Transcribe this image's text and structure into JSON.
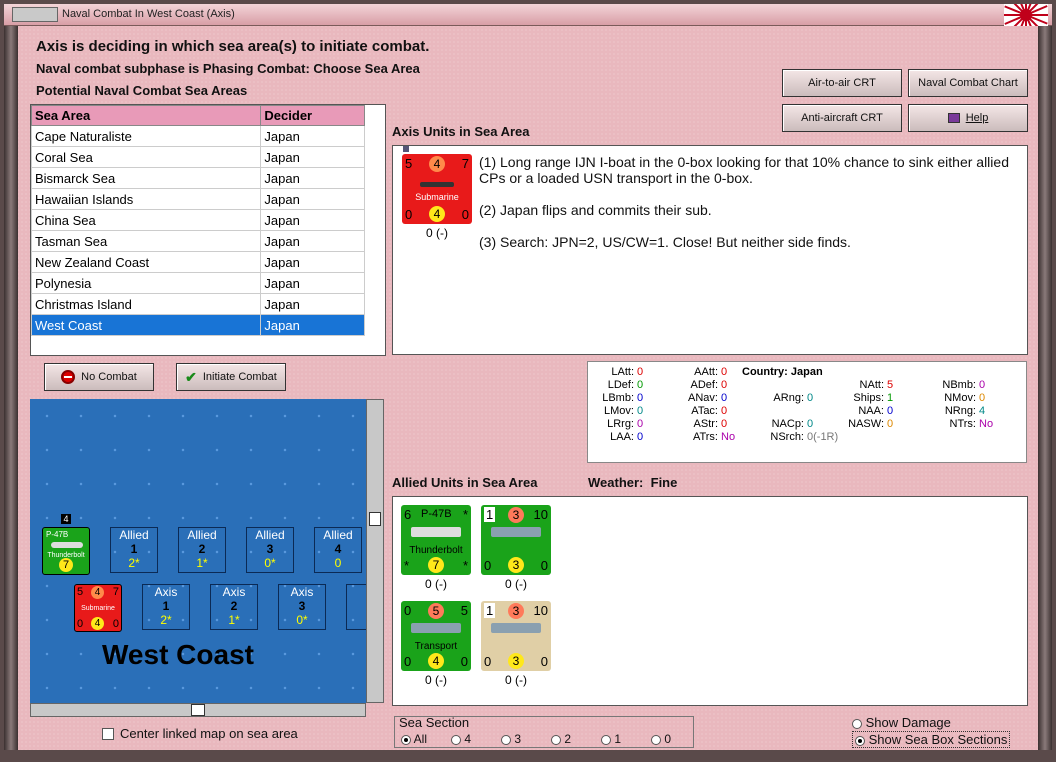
{
  "window": {
    "title": "Naval Combat In West Coast (Axis)"
  },
  "headings": {
    "line1": "Axis is deciding in which sea area(s) to initiate combat.",
    "line2": "Naval combat subphase is Phasing Combat: Choose Sea Area",
    "line3": "Potential Naval Combat Sea Areas"
  },
  "buttons": {
    "air_to_air": "Air-to-air CRT",
    "naval_chart": "Naval Combat Chart",
    "anti_aircraft": "Anti-aircraft CRT",
    "help": "Help",
    "no_combat": "No Combat",
    "initiate_combat": "Initiate Combat"
  },
  "sea_table": {
    "headers": [
      "Sea Area",
      "Decider"
    ],
    "rows": [
      [
        "Cape Naturaliste",
        "Japan"
      ],
      [
        "Coral Sea",
        "Japan"
      ],
      [
        "Bismarck Sea",
        "Japan"
      ],
      [
        "Hawaiian Islands",
        "Japan"
      ],
      [
        "China Sea",
        "Japan"
      ],
      [
        "Tasman Sea",
        "Japan"
      ],
      [
        "New Zealand Coast",
        "Japan"
      ],
      [
        "Polynesia",
        "Japan"
      ],
      [
        "Christmas Island",
        "Japan"
      ],
      [
        "West Coast",
        "Japan"
      ]
    ],
    "selected_index": 9
  },
  "axis_units": {
    "title": "Axis Units in Sea Area",
    "sub": {
      "tl": "5",
      "tc": "4",
      "tr": "7",
      "name": "Submarine",
      "bl": "0",
      "bc": "4",
      "br": "0",
      "under": "0 (-)"
    },
    "notes": [
      "(1) Long range IJN I-boat in the 0-box looking for that 10% chance to sink either allied CPs or a loaded USN transport in the 0-box.",
      "(2) Japan flips and commits their sub.",
      "(3) Search:  JPN=2, US/CW=1.  Close!  But neither side finds."
    ]
  },
  "stats": {
    "country_label": "Country:",
    "country": "Japan",
    "items": [
      {
        "k": "LAtt:",
        "v": "0",
        "c": "v-red"
      },
      {
        "k": "LDef:",
        "v": "0",
        "c": "v-green"
      },
      {
        "k": "LBmb:",
        "v": "0",
        "c": "v-blue"
      },
      {
        "k": "LMov:",
        "v": "0",
        "c": "v-teal"
      },
      {
        "k": "LRrg:",
        "v": "0",
        "c": "v-purple"
      },
      {
        "k": "LAA:",
        "v": "0",
        "c": "v-blue"
      },
      {
        "k": "AAtt:",
        "v": "0",
        "c": "v-red"
      },
      {
        "k": "ADef:",
        "v": "0",
        "c": "v-red"
      },
      {
        "k": "ANav:",
        "v": "0",
        "c": "v-blue"
      },
      {
        "k": "ATac:",
        "v": "0",
        "c": "v-red"
      },
      {
        "k": "AStr:",
        "v": "0",
        "c": "v-red"
      },
      {
        "k": "ATrs:",
        "v": "No",
        "c": "v-purple"
      },
      {
        "k": "ARng:",
        "v": "0",
        "c": "v-teal"
      },
      {
        "k": "NACp:",
        "v": "0",
        "c": "v-teal"
      },
      {
        "k": "NSrch:",
        "v": "0(-1R)",
        "c": "v-gray"
      },
      {
        "k": "NAtt:",
        "v": "5",
        "c": "v-red"
      },
      {
        "k": "Ships:",
        "v": "1",
        "c": "v-green"
      },
      {
        "k": "NAA:",
        "v": "0",
        "c": "v-blue"
      },
      {
        "k": "NASW:",
        "v": "0",
        "c": "v-orange"
      },
      {
        "k": "NBmb:",
        "v": "0",
        "c": "v-purple"
      },
      {
        "k": "NMov:",
        "v": "0",
        "c": "v-orange"
      },
      {
        "k": "NRng:",
        "v": "4",
        "c": "v-teal"
      },
      {
        "k": "NTrs:",
        "v": "No",
        "c": "v-purple"
      }
    ]
  },
  "allied": {
    "title": "Allied Units in Sea Area",
    "weather_label": "Weather:",
    "weather": "Fine",
    "units": [
      {
        "tl": "6",
        "tc": "P-47B",
        "tr": "*",
        "name": "Thunderbolt",
        "bl": "*",
        "bc": "7",
        "br": "*",
        "under": "0 (-)"
      },
      {
        "tl": "1",
        "tc": "3",
        "tr": "10",
        "name": "",
        "bl": "0",
        "bc": "3",
        "br": "0",
        "under": "0 (-)"
      },
      {
        "tl": "0",
        "tc": "5",
        "tr": "5",
        "name": "Transport",
        "bl": "0",
        "bc": "4",
        "br": "0",
        "under": "0 (-)"
      },
      {
        "tl": "1",
        "tc": "3",
        "tr": "10",
        "name": "",
        "bl": "0",
        "bc": "3",
        "br": "0",
        "under": "0 (-)"
      }
    ]
  },
  "map": {
    "title": "West Coast",
    "stack_count": "4",
    "allied_boxes": [
      {
        "l": "Allied",
        "n": "1",
        "s": "2*"
      },
      {
        "l": "Allied",
        "n": "2",
        "s": "1*"
      },
      {
        "l": "Allied",
        "n": "3",
        "s": "0*"
      },
      {
        "l": "Allied",
        "n": "4",
        "s": "0"
      }
    ],
    "axis_boxes": [
      {
        "l": "Axis",
        "n": "1",
        "s": "2*"
      },
      {
        "l": "Axis",
        "n": "2",
        "s": "1*"
      },
      {
        "l": "Axis",
        "n": "3",
        "s": "0*"
      },
      {
        "l": "A",
        "n": "",
        "s": ""
      }
    ],
    "p47": {
      "name": "P-47B",
      "sub": "Thunderbolt",
      "val": "7"
    },
    "sub": {
      "tl": "5",
      "tc": "4",
      "tr": "7",
      "name": "Submarine",
      "bl": "0",
      "bc": "4",
      "br": "0"
    }
  },
  "controls": {
    "center_map": "Center linked map on sea area",
    "sea_section": "Sea Section",
    "sections": [
      "All",
      "4",
      "3",
      "2",
      "1",
      "0"
    ],
    "show_damage": "Show Damage",
    "show_boxes": "Show Sea Box Sections"
  }
}
